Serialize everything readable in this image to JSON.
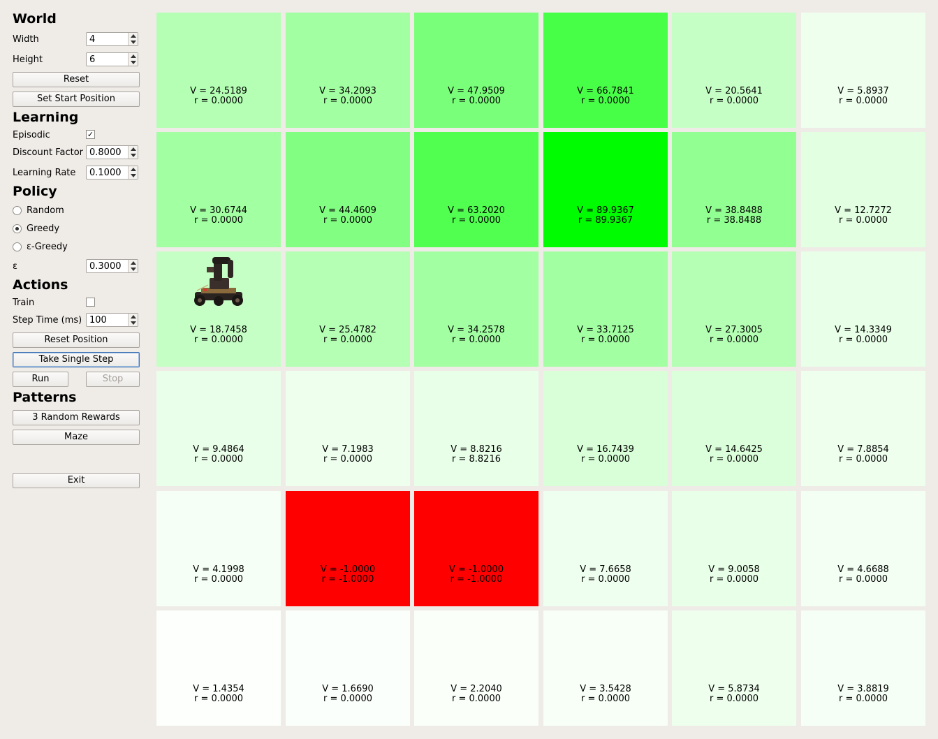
{
  "world": {
    "title": "World",
    "width_label": "Width",
    "width_value": "4",
    "height_label": "Height",
    "height_value": "6",
    "reset_button": "Reset",
    "set_start_button": "Set Start Position"
  },
  "learning": {
    "title": "Learning",
    "episodic_label": "Episodic",
    "episodic_checked": "✓",
    "discount_label": "Discount Factor",
    "discount_value": "0.8000",
    "rate_label": "Learning Rate",
    "rate_value": "0.1000"
  },
  "policy": {
    "title": "Policy",
    "options": [
      "Random",
      "Greedy",
      "ε-Greedy"
    ],
    "selected": "Greedy",
    "epsilon_label": "ε",
    "epsilon_value": "0.3000"
  },
  "actions": {
    "title": "Actions",
    "train_label": "Train",
    "step_time_label": "Step Time (ms)",
    "step_time_value": "100",
    "reset_position_button": "Reset Position",
    "single_step_button": "Take Single Step",
    "run_button": "Run",
    "stop_button": "Stop"
  },
  "patterns": {
    "title": "Patterns",
    "random_rewards_button": "3 Random Rewards",
    "maze_button": "Maze"
  },
  "exit_button": "Exit",
  "grid": {
    "rows": [
      [
        {
          "v": "V = 24.5189",
          "r": "r = 0.0000",
          "color": "#b4ffb4"
        },
        {
          "v": "V = 34.2093",
          "r": "r = 0.0000",
          "color": "#a2ffa2"
        },
        {
          "v": "V = 47.9509",
          "r": "r = 0.0000",
          "color": "#7aff7a"
        },
        {
          "v": "V = 66.7841",
          "r": "r = 0.0000",
          "color": "#48ff48"
        },
        {
          "v": "V = 20.5641",
          "r": "r = 0.0000",
          "color": "#c6ffc6"
        },
        {
          "v": "V = 5.8937",
          "r": "r = 0.0000",
          "color": "#eeffee"
        }
      ],
      [
        {
          "v": "V = 30.6744",
          "r": "r = 0.0000",
          "color": "#a2ffa2"
        },
        {
          "v": "V = 44.4609",
          "r": "r = 0.0000",
          "color": "#82ff82"
        },
        {
          "v": "V = 63.2020",
          "r": "r = 0.0000",
          "color": "#50ff50"
        },
        {
          "v": "V = 89.9367",
          "r": "r = 89.9367",
          "color": "#00fc00"
        },
        {
          "v": "V = 38.8488",
          "r": "r = 38.8488",
          "color": "#92ff92"
        },
        {
          "v": "V = 12.7272",
          "r": "r = 0.0000",
          "color": "#e2ffe2"
        }
      ],
      [
        {
          "v": "V = 18.7458",
          "r": "r = 0.0000",
          "color": "#c6ffc6",
          "robot": true
        },
        {
          "v": "V = 25.4782",
          "r": "r = 0.0000",
          "color": "#b4ffb4"
        },
        {
          "v": "V = 34.2578",
          "r": "r = 0.0000",
          "color": "#a2ffa2"
        },
        {
          "v": "V = 33.7125",
          "r": "r = 0.0000",
          "color": "#a2ffa2"
        },
        {
          "v": "V = 27.3005",
          "r": "r = 0.0000",
          "color": "#b4ffb4"
        },
        {
          "v": "V = 14.3349",
          "r": "r = 0.0000",
          "color": "#e8ffe8"
        }
      ],
      [
        {
          "v": "V = 9.4864",
          "r": "r = 0.0000",
          "color": "#eaffea"
        },
        {
          "v": "V = 7.1983",
          "r": "r = 0.0000",
          "color": "#eeffee"
        },
        {
          "v": "V = 8.8216",
          "r": "r = 8.8216",
          "color": "#e8ffe8"
        },
        {
          "v": "V = 16.7439",
          "r": "r = 0.0000",
          "color": "#d8ffd8"
        },
        {
          "v": "V = 14.6425",
          "r": "r = 0.0000",
          "color": "#daffda"
        },
        {
          "v": "V = 7.8854",
          "r": "r = 0.0000",
          "color": "#eeffee"
        }
      ],
      [
        {
          "v": "V = 4.1998",
          "r": "r = 0.0000",
          "color": "#f5fff5"
        },
        {
          "v": "V = -1.0000",
          "r": "r = -1.0000",
          "color": "#ff0000"
        },
        {
          "v": "V = -1.0000",
          "r": "r = -1.0000",
          "color": "#ff0000"
        },
        {
          "v": "V = 7.6658",
          "r": "r = 0.0000",
          "color": "#efffef"
        },
        {
          "v": "V = 9.0058",
          "r": "r = 0.0000",
          "color": "#e8ffe8"
        },
        {
          "v": "V = 4.6688",
          "r": "r = 0.0000",
          "color": "#f3fff3"
        }
      ],
      [
        {
          "v": "V = 1.4354",
          "r": "r = 0.0000",
          "color": "#fcfffc"
        },
        {
          "v": "V = 1.6690",
          "r": "r = 0.0000",
          "color": "#fbfffb"
        },
        {
          "v": "V = 2.2040",
          "r": "r = 0.0000",
          "color": "#fafffa"
        },
        {
          "v": "V = 3.5428",
          "r": "r = 0.0000",
          "color": "#f7fff7"
        },
        {
          "v": "V = 5.8734",
          "r": "r = 0.0000",
          "color": "#eeffee"
        },
        {
          "v": "V = 3.8819",
          "r": "r = 0.0000",
          "color": "#f5fff5"
        }
      ]
    ]
  }
}
